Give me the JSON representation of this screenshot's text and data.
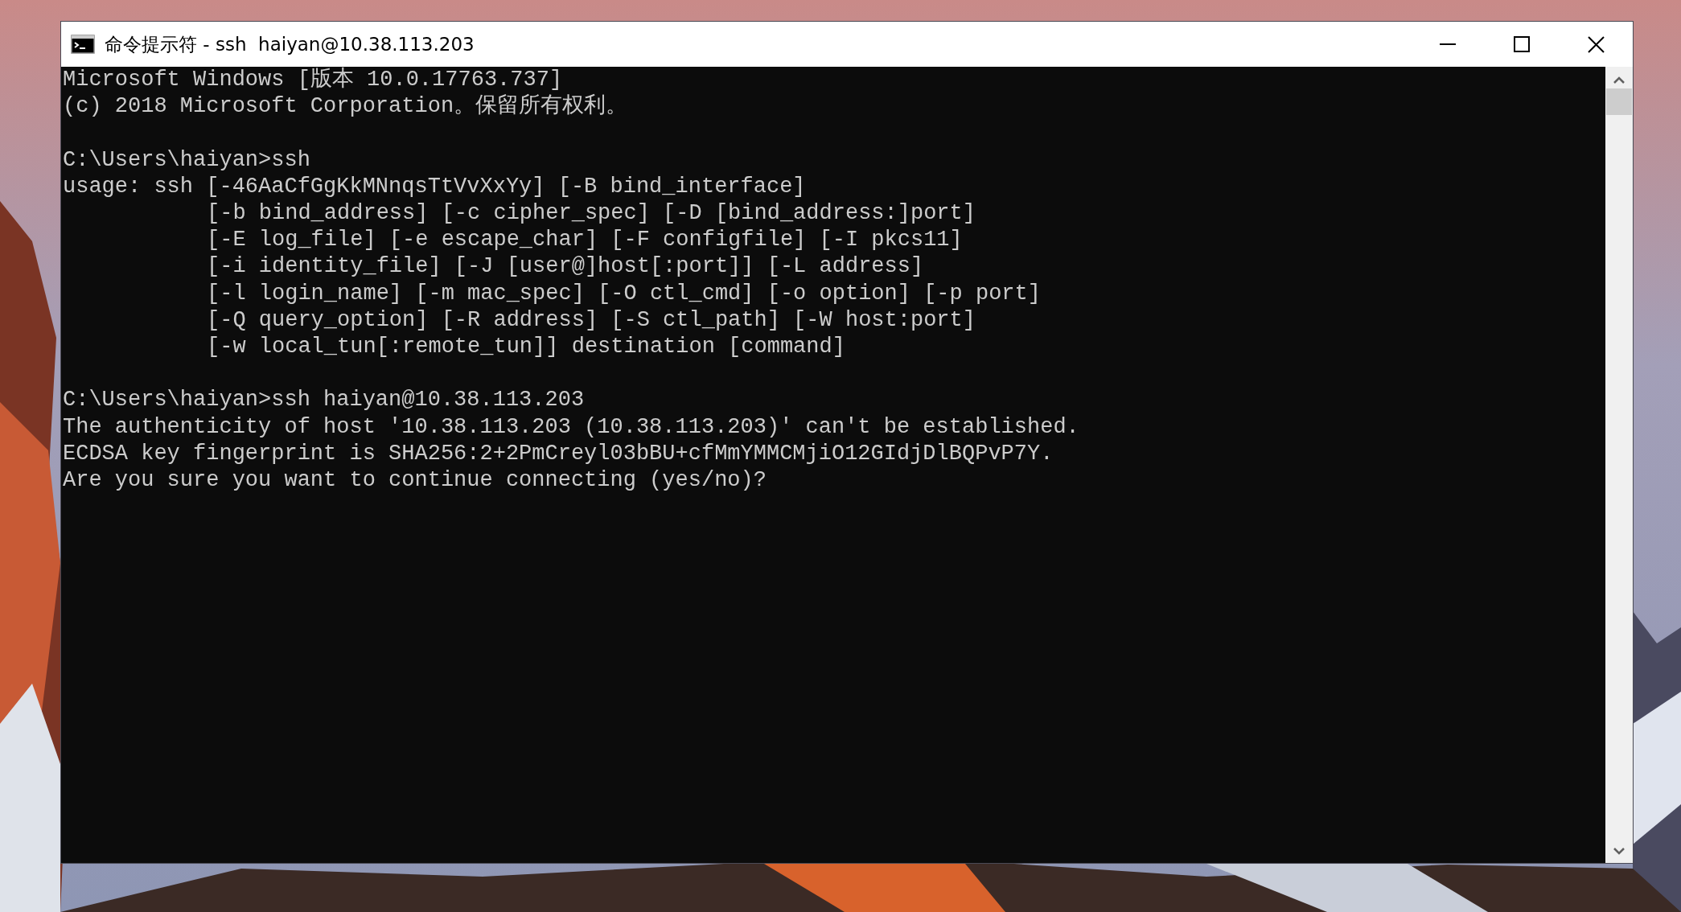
{
  "window": {
    "title": "命令提示符 - ssh  haiyan@10.38.113.203"
  },
  "terminal": {
    "blocks": [
      {
        "lines": [
          {
            "kind": "output",
            "text": "Microsoft Windows [版本 10.0.17763.737]"
          },
          {
            "kind": "output",
            "text": "(c) 2018 Microsoft Corporation。保留所有权利。"
          }
        ]
      },
      {
        "lines": [
          {
            "kind": "output",
            "text": "C:\\Users\\haiyan>ssh"
          },
          {
            "kind": "output",
            "text": "usage: ssh [-46AaCfGgKkMNnqsTtVvXxYy] [-B bind_interface]"
          },
          {
            "kind": "continuation",
            "text": "[-b bind_address] [-c cipher_spec] [-D [bind_address:]port]"
          },
          {
            "kind": "continuation",
            "text": "[-E log_file] [-e escape_char] [-F configfile] [-I pkcs11]"
          },
          {
            "kind": "continuation",
            "text": "[-i identity_file] [-J [user@]host[:port]] [-L address]"
          },
          {
            "kind": "continuation",
            "text": "[-l login_name] [-m mac_spec] [-O ctl_cmd] [-o option] [-p port]"
          },
          {
            "kind": "continuation",
            "text": "[-Q query_option] [-R address] [-S ctl_path] [-W host:port]"
          },
          {
            "kind": "continuation",
            "text": "[-w local_tun[:remote_tun]] destination [command]"
          }
        ]
      },
      {
        "lines": [
          {
            "kind": "output",
            "text": "C:\\Users\\haiyan>ssh haiyan@10.38.113.203"
          },
          {
            "kind": "output",
            "text": "The authenticity of host '10.38.113.203 (10.38.113.203)' can't be established."
          },
          {
            "kind": "output",
            "text": "ECDSA key fingerprint is SHA256:2+2PmCreyl03bBU+cfMmYMMCMjiO12GIdjDlBQPvP7Y."
          },
          {
            "kind": "output",
            "text": "Are you sure you want to continue connecting (yes/no)?"
          }
        ]
      }
    ]
  }
}
